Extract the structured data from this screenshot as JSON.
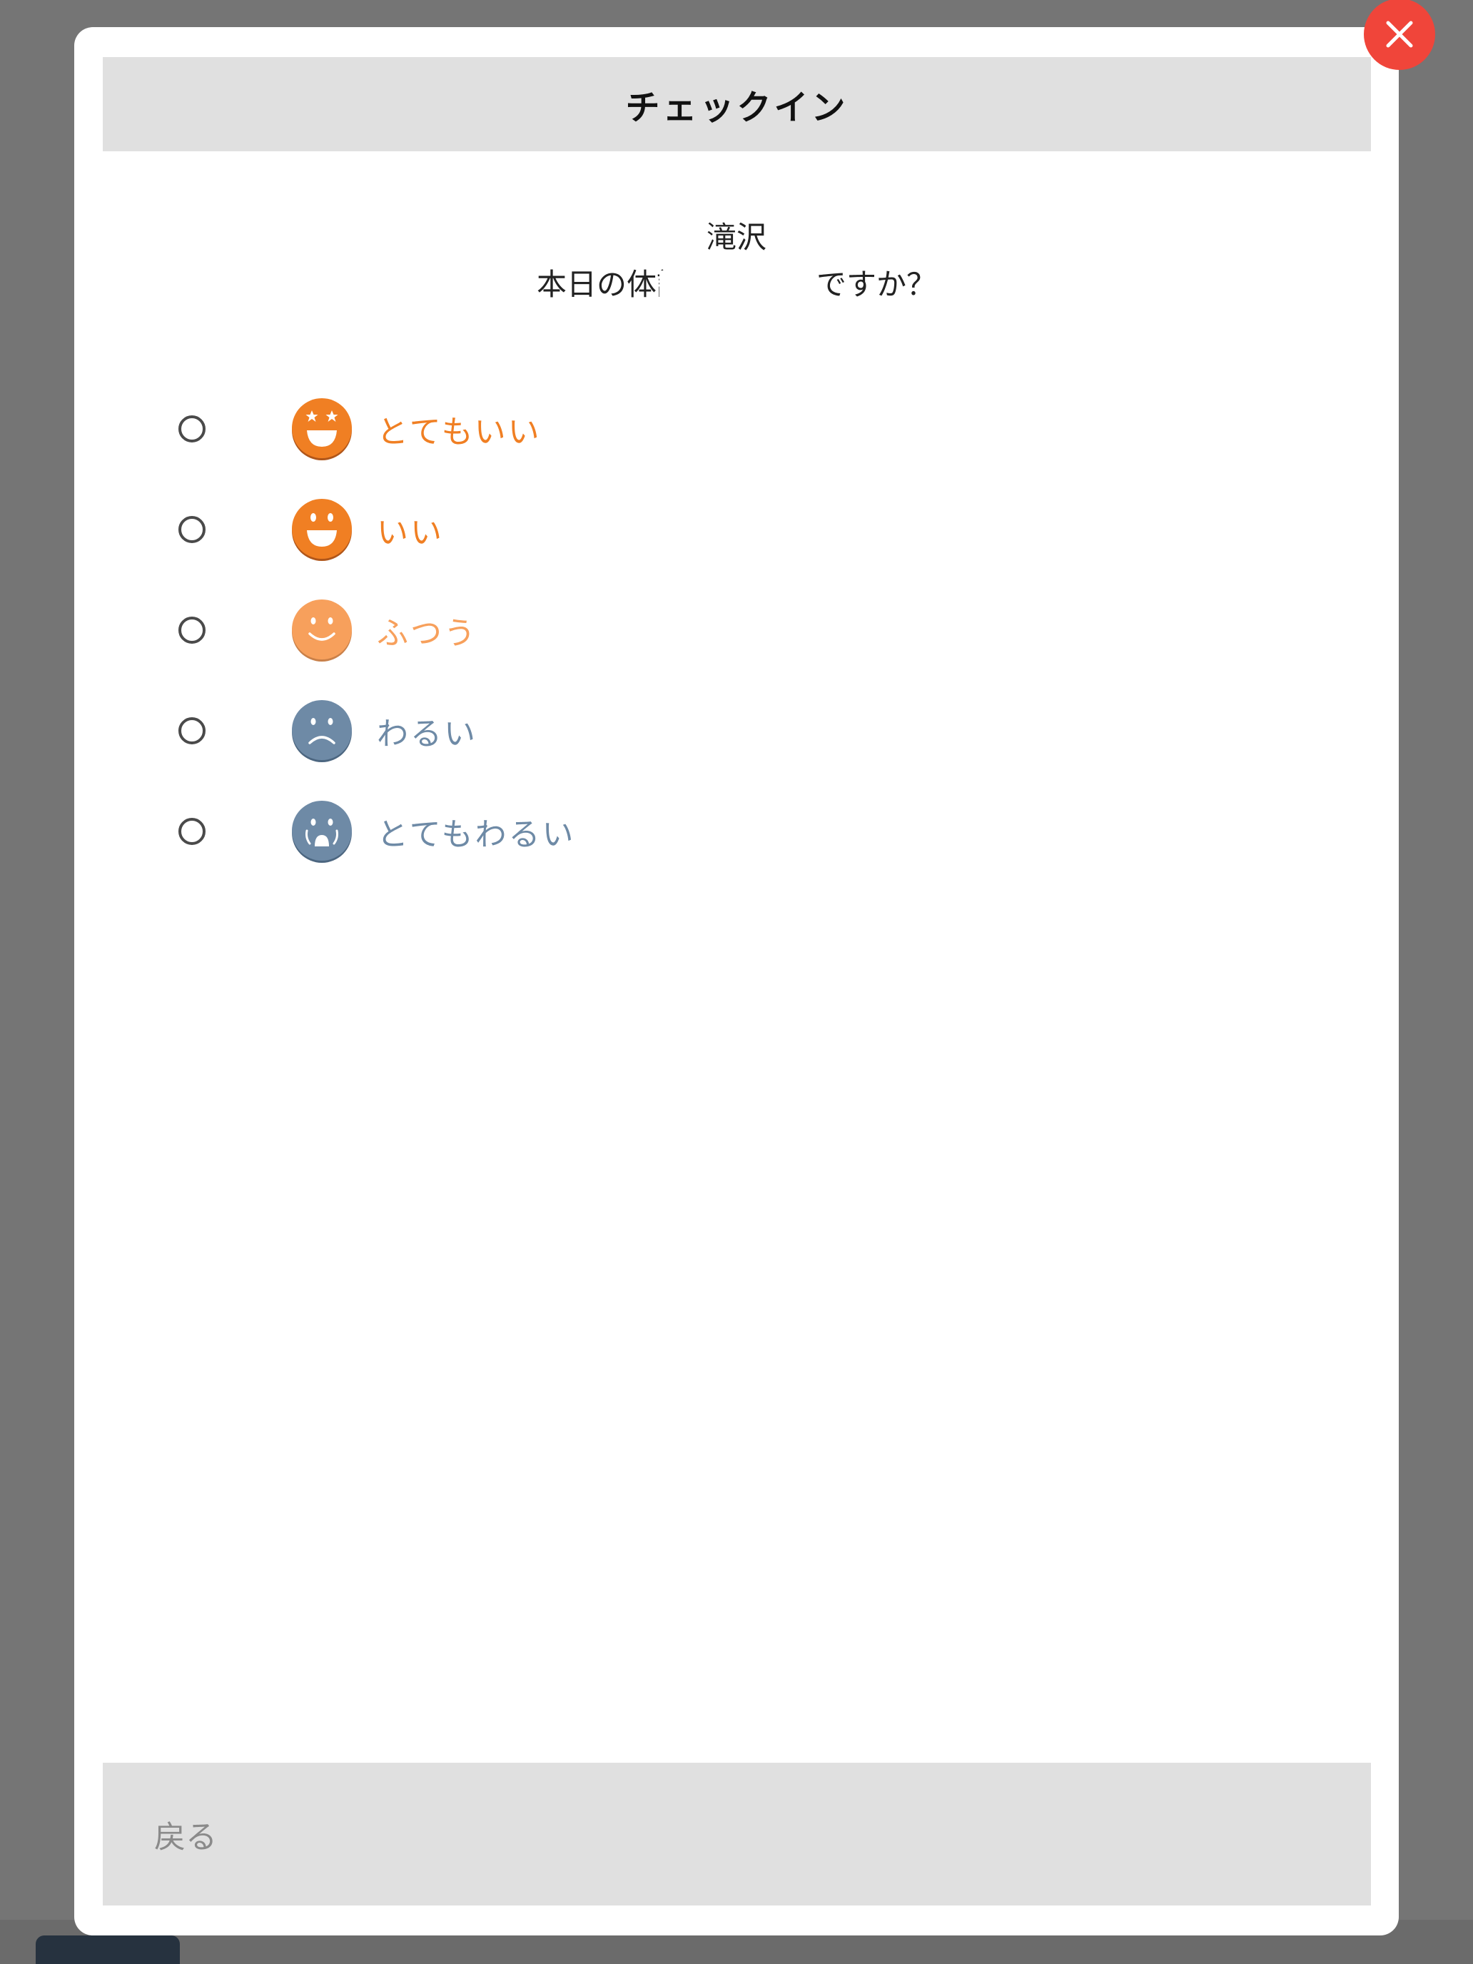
{
  "modal": {
    "title": "チェックイン",
    "question_name": "滝沢",
    "question_prefix": "本日の体調",
    "question_suffix": "ですか？"
  },
  "options": [
    {
      "label": "とてもいい",
      "color": "#f07f23",
      "icon": "very-happy-face-icon"
    },
    {
      "label": "いい",
      "color": "#f07f23",
      "icon": "happy-face-icon"
    },
    {
      "label": "ふつう",
      "color": "#f7a05c",
      "icon": "neutral-face-icon"
    },
    {
      "label": "わるい",
      "color": "#6e8aa6",
      "icon": "sad-face-icon"
    },
    {
      "label": "とてもわるい",
      "color": "#6e8aa6",
      "icon": "very-sad-face-icon"
    }
  ],
  "footer": {
    "back_label": "戻る"
  },
  "colors": {
    "close_button": "#f0453a",
    "header_bg": "#e0e0e0"
  }
}
